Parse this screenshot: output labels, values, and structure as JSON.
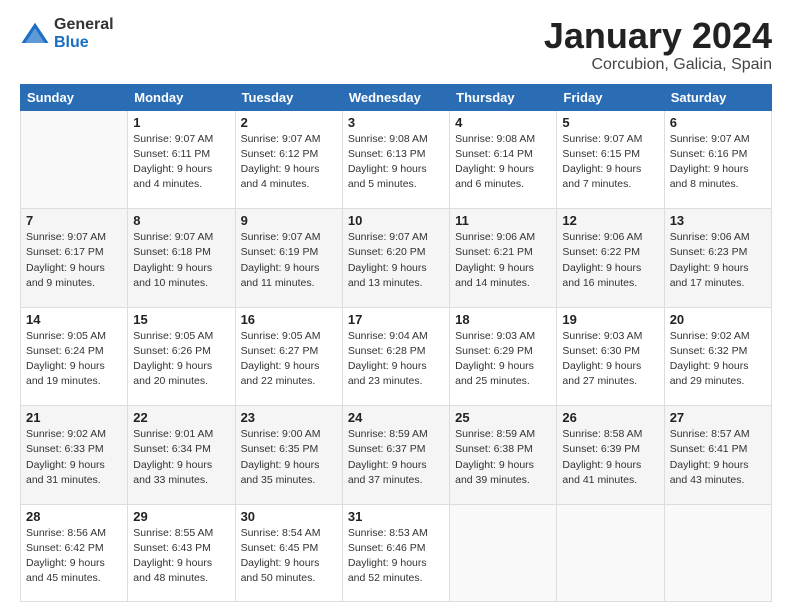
{
  "header": {
    "logo_general": "General",
    "logo_blue": "Blue",
    "title": "January 2024",
    "location": "Corcubion, Galicia, Spain"
  },
  "days_of_week": [
    "Sunday",
    "Monday",
    "Tuesday",
    "Wednesday",
    "Thursday",
    "Friday",
    "Saturday"
  ],
  "weeks": [
    [
      {
        "num": "",
        "info": ""
      },
      {
        "num": "1",
        "info": "Sunrise: 9:07 AM\nSunset: 6:11 PM\nDaylight: 9 hours\nand 4 minutes."
      },
      {
        "num": "2",
        "info": "Sunrise: 9:07 AM\nSunset: 6:12 PM\nDaylight: 9 hours\nand 4 minutes."
      },
      {
        "num": "3",
        "info": "Sunrise: 9:08 AM\nSunset: 6:13 PM\nDaylight: 9 hours\nand 5 minutes."
      },
      {
        "num": "4",
        "info": "Sunrise: 9:08 AM\nSunset: 6:14 PM\nDaylight: 9 hours\nand 6 minutes."
      },
      {
        "num": "5",
        "info": "Sunrise: 9:07 AM\nSunset: 6:15 PM\nDaylight: 9 hours\nand 7 minutes."
      },
      {
        "num": "6",
        "info": "Sunrise: 9:07 AM\nSunset: 6:16 PM\nDaylight: 9 hours\nand 8 minutes."
      }
    ],
    [
      {
        "num": "7",
        "info": "Sunrise: 9:07 AM\nSunset: 6:17 PM\nDaylight: 9 hours\nand 9 minutes."
      },
      {
        "num": "8",
        "info": "Sunrise: 9:07 AM\nSunset: 6:18 PM\nDaylight: 9 hours\nand 10 minutes."
      },
      {
        "num": "9",
        "info": "Sunrise: 9:07 AM\nSunset: 6:19 PM\nDaylight: 9 hours\nand 11 minutes."
      },
      {
        "num": "10",
        "info": "Sunrise: 9:07 AM\nSunset: 6:20 PM\nDaylight: 9 hours\nand 13 minutes."
      },
      {
        "num": "11",
        "info": "Sunrise: 9:06 AM\nSunset: 6:21 PM\nDaylight: 9 hours\nand 14 minutes."
      },
      {
        "num": "12",
        "info": "Sunrise: 9:06 AM\nSunset: 6:22 PM\nDaylight: 9 hours\nand 16 minutes."
      },
      {
        "num": "13",
        "info": "Sunrise: 9:06 AM\nSunset: 6:23 PM\nDaylight: 9 hours\nand 17 minutes."
      }
    ],
    [
      {
        "num": "14",
        "info": "Sunrise: 9:05 AM\nSunset: 6:24 PM\nDaylight: 9 hours\nand 19 minutes."
      },
      {
        "num": "15",
        "info": "Sunrise: 9:05 AM\nSunset: 6:26 PM\nDaylight: 9 hours\nand 20 minutes."
      },
      {
        "num": "16",
        "info": "Sunrise: 9:05 AM\nSunset: 6:27 PM\nDaylight: 9 hours\nand 22 minutes."
      },
      {
        "num": "17",
        "info": "Sunrise: 9:04 AM\nSunset: 6:28 PM\nDaylight: 9 hours\nand 23 minutes."
      },
      {
        "num": "18",
        "info": "Sunrise: 9:03 AM\nSunset: 6:29 PM\nDaylight: 9 hours\nand 25 minutes."
      },
      {
        "num": "19",
        "info": "Sunrise: 9:03 AM\nSunset: 6:30 PM\nDaylight: 9 hours\nand 27 minutes."
      },
      {
        "num": "20",
        "info": "Sunrise: 9:02 AM\nSunset: 6:32 PM\nDaylight: 9 hours\nand 29 minutes."
      }
    ],
    [
      {
        "num": "21",
        "info": "Sunrise: 9:02 AM\nSunset: 6:33 PM\nDaylight: 9 hours\nand 31 minutes."
      },
      {
        "num": "22",
        "info": "Sunrise: 9:01 AM\nSunset: 6:34 PM\nDaylight: 9 hours\nand 33 minutes."
      },
      {
        "num": "23",
        "info": "Sunrise: 9:00 AM\nSunset: 6:35 PM\nDaylight: 9 hours\nand 35 minutes."
      },
      {
        "num": "24",
        "info": "Sunrise: 8:59 AM\nSunset: 6:37 PM\nDaylight: 9 hours\nand 37 minutes."
      },
      {
        "num": "25",
        "info": "Sunrise: 8:59 AM\nSunset: 6:38 PM\nDaylight: 9 hours\nand 39 minutes."
      },
      {
        "num": "26",
        "info": "Sunrise: 8:58 AM\nSunset: 6:39 PM\nDaylight: 9 hours\nand 41 minutes."
      },
      {
        "num": "27",
        "info": "Sunrise: 8:57 AM\nSunset: 6:41 PM\nDaylight: 9 hours\nand 43 minutes."
      }
    ],
    [
      {
        "num": "28",
        "info": "Sunrise: 8:56 AM\nSunset: 6:42 PM\nDaylight: 9 hours\nand 45 minutes."
      },
      {
        "num": "29",
        "info": "Sunrise: 8:55 AM\nSunset: 6:43 PM\nDaylight: 9 hours\nand 48 minutes."
      },
      {
        "num": "30",
        "info": "Sunrise: 8:54 AM\nSunset: 6:45 PM\nDaylight: 9 hours\nand 50 minutes."
      },
      {
        "num": "31",
        "info": "Sunrise: 8:53 AM\nSunset: 6:46 PM\nDaylight: 9 hours\nand 52 minutes."
      },
      {
        "num": "",
        "info": ""
      },
      {
        "num": "",
        "info": ""
      },
      {
        "num": "",
        "info": ""
      }
    ]
  ]
}
